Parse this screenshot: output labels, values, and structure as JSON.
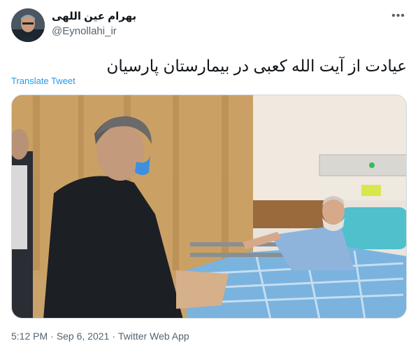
{
  "author": {
    "display_name": "بهرام عین اللهی",
    "handle": "@Eynollahi_ir"
  },
  "tweet": {
    "text": "عیادت از آیت الله کعبی در بیمارستان پارسیان",
    "translate_label": "Translate Tweet"
  },
  "media": {
    "type": "photo"
  },
  "meta": {
    "time": "5:12 PM",
    "separator": "·",
    "date": "Sep 6, 2021",
    "source": "Twitter Web App"
  },
  "icons": {
    "more": "more-horizontal-icon"
  }
}
